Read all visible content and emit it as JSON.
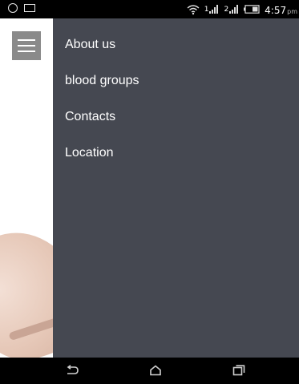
{
  "status_bar": {
    "time": "4:57",
    "ampm": "pm",
    "left_icons": [
      "alarm-icon",
      "screen-icon"
    ],
    "right_icons": [
      "wifi-icon",
      "signal-1-icon",
      "signal-2-icon",
      "battery-icon"
    ],
    "sim1_label": "1",
    "sim2_label": "2"
  },
  "header": {
    "menu_icon": "hamburger-icon"
  },
  "drawer": {
    "background": "#454851",
    "items": [
      {
        "label": "About us"
      },
      {
        "label": "blood groups"
      },
      {
        "label": "Contacts"
      },
      {
        "label": "Location"
      }
    ]
  },
  "nav_bar": {
    "buttons": [
      "back-icon",
      "home-icon",
      "recents-icon"
    ]
  }
}
